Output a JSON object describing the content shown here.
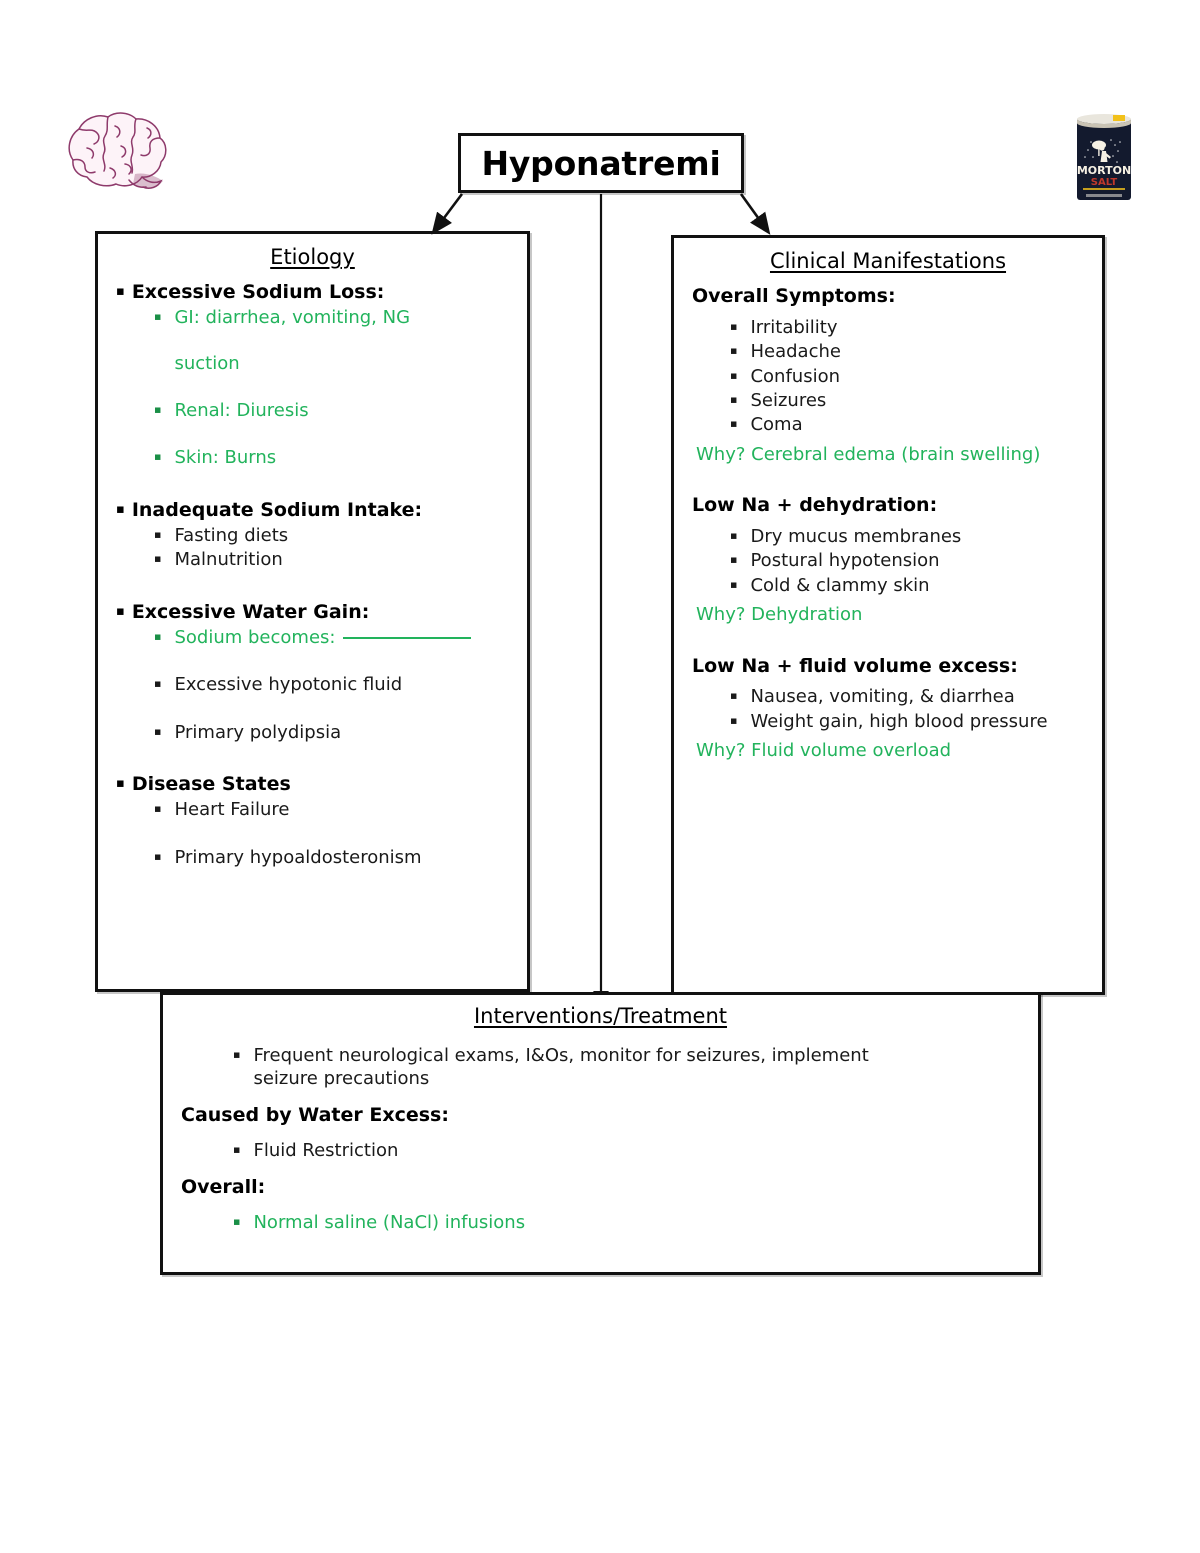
{
  "title_node": {
    "label": "Hyponatremi"
  },
  "artwork": {
    "brain": "brain-illustration",
    "salt": "morton-salt-container-illustration",
    "salt_brand": "MORTON",
    "salt_product": "SALT"
  },
  "colors": {
    "green_accent": "#22b35c",
    "box_border": "#111111",
    "text": "#000000",
    "brain_line": "#8e3a6b",
    "salt_body": "#131a2e",
    "salt_yellow": "#f2c11a"
  },
  "etiology": {
    "heading": "Etiology",
    "groups": [
      {
        "head": "Excessive Sodium Loss:",
        "items": [
          {
            "text": "GI: diarrhea, vomiting, NG",
            "cont": "suction",
            "green": true,
            "spaced": true
          },
          {
            "text": "Renal: Diuresis",
            "green": true,
            "spaced": true
          },
          {
            "text": "Skin: Burns",
            "green": true,
            "spaced": false
          }
        ]
      },
      {
        "head": "Inadequate Sodium Intake:",
        "items": [
          {
            "text": "Fasting diets",
            "green": false,
            "spaced": false
          },
          {
            "text": "Malnutrition",
            "green": false,
            "spaced": false
          }
        ]
      },
      {
        "head": "Excessive Water Gain:",
        "items": [
          {
            "text": "Sodium becomes:",
            "green": true,
            "blank": true,
            "spaced": true
          },
          {
            "text": "Excessive hypotonic fluid",
            "green": false,
            "spaced": true
          },
          {
            "text": "Primary polydipsia",
            "green": false,
            "spaced": false
          }
        ]
      },
      {
        "head": "Disease States",
        "items": [
          {
            "text": "Heart Failure",
            "green": false,
            "spaced": true
          },
          {
            "text": "Primary hypoaldosteronism",
            "green": false,
            "spaced": false
          }
        ]
      }
    ]
  },
  "clinical": {
    "heading": "Clinical Manifestations",
    "groups": [
      {
        "head": "Overall Symptoms:",
        "items": [
          "Irritability",
          "Headache",
          "Confusion",
          "Seizures",
          "Coma"
        ],
        "why": "Why? Cerebral edema (brain swelling)"
      },
      {
        "head": "Low Na + dehydration:",
        "items": [
          "Dry mucus membranes",
          "Postural hypotension",
          "Cold & clammy skin"
        ],
        "why": "Why? Dehydration"
      },
      {
        "head": "Low Na + fluid volume excess:",
        "items": [
          "Nausea, vomiting, & diarrhea",
          "Weight gain, high blood pressure"
        ],
        "why": "Why? Fluid volume overload"
      }
    ]
  },
  "interventions": {
    "heading": "Interventions/Treatment",
    "intro_item": "Frequent neurological exams, I&Os, monitor for seizures, implement",
    "intro_item_cont": "seizure precautions",
    "sections": [
      {
        "head": "Caused by Water Excess:",
        "items": [
          {
            "text": "Fluid Restriction",
            "green": false
          }
        ]
      },
      {
        "head": "Overall:",
        "items": [
          {
            "text": "Normal saline (NaCl) infusions",
            "green": true
          }
        ]
      }
    ]
  },
  "glyphs": {
    "square_bullet": "▪"
  }
}
